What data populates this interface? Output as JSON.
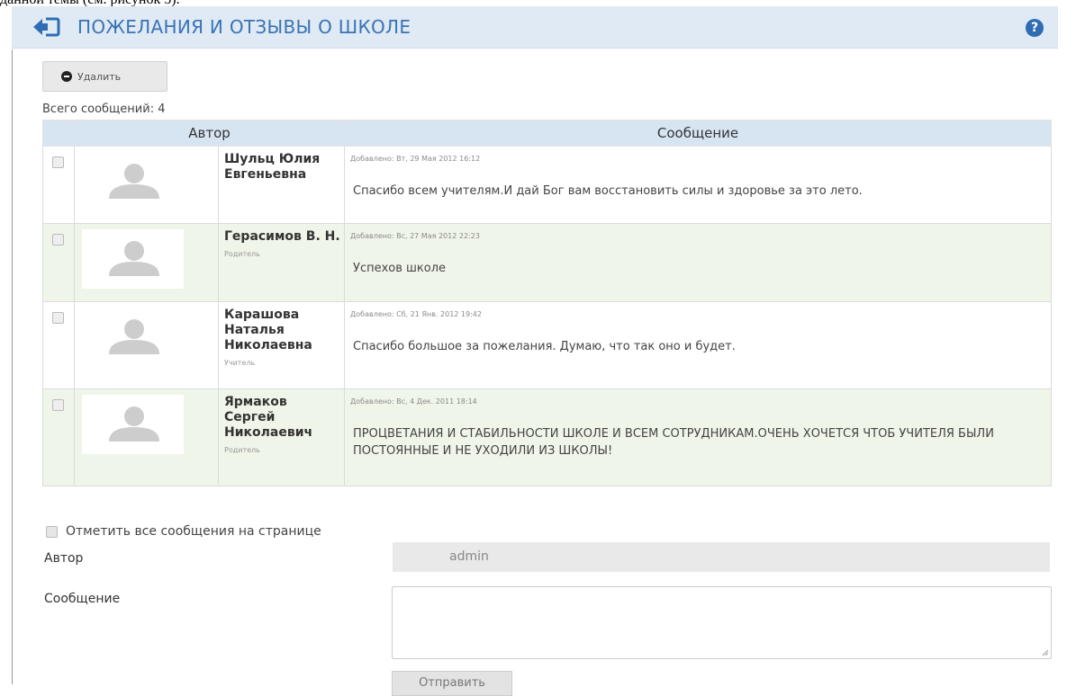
{
  "doc_caption": "данной темы (см. рисунок 5).",
  "header": {
    "title": "ПОЖЕЛАНИЯ И ОТЗЫВЫ О ШКОЛЕ",
    "help": "?"
  },
  "toolbar": {
    "delete_label": "Удалить"
  },
  "total": "Всего сообщений: 4",
  "table": {
    "col_author": "Автор",
    "col_message": "Сообщение",
    "rows": [
      {
        "name": "Шульц Юлия Евгеньевна",
        "role": "",
        "added": "Добавлено: Вт, 29 Мая 2012 16:12",
        "text": "Спасибо всем учителям.И дай Бог вам восстановить силы и здоровье за это лето."
      },
      {
        "name": "Герасимов В. Н.",
        "role": "Родитель",
        "added": "Добавлено: Вс, 27 Мая 2012 22:23",
        "text": "Успехов школе"
      },
      {
        "name": "Карашова Наталья Николаевна",
        "role": "Учитель",
        "added": "Добавлено: Сб, 21 Янв. 2012 19:42",
        "text": "Спасибо большое за пожелания. Думаю, что так оно и будет."
      },
      {
        "name": "Ярмаков Сергей Николаевич",
        "role": "Родитель",
        "added": "Добавлено: Вс, 4 Дек. 2011 18:14",
        "text": "ПРОЦВЕТАНИЯ И СТАБИЛЬНОСТИ ШКОЛЕ И ВСЕМ СОТРУДНИКАМ.ОЧЕНЬ ХОЧЕТСЯ ЧТОБ УЧИТЕЛЯ БЫЛИ ПОСТОЯННЫЕ И НЕ УХОДИЛИ ИЗ ШКОЛЫ!"
      }
    ]
  },
  "form": {
    "mark_all": "Отметить все сообщения на странице",
    "author_label": "Автор",
    "author_value": "admin",
    "message_label": "Сообщение",
    "submit_label": "Отправить"
  },
  "colors": {
    "header_bg": "#dfeaf5",
    "title": "#3a73b6",
    "table_head": "#d7e5f2",
    "row_green": "#eff5e9"
  }
}
